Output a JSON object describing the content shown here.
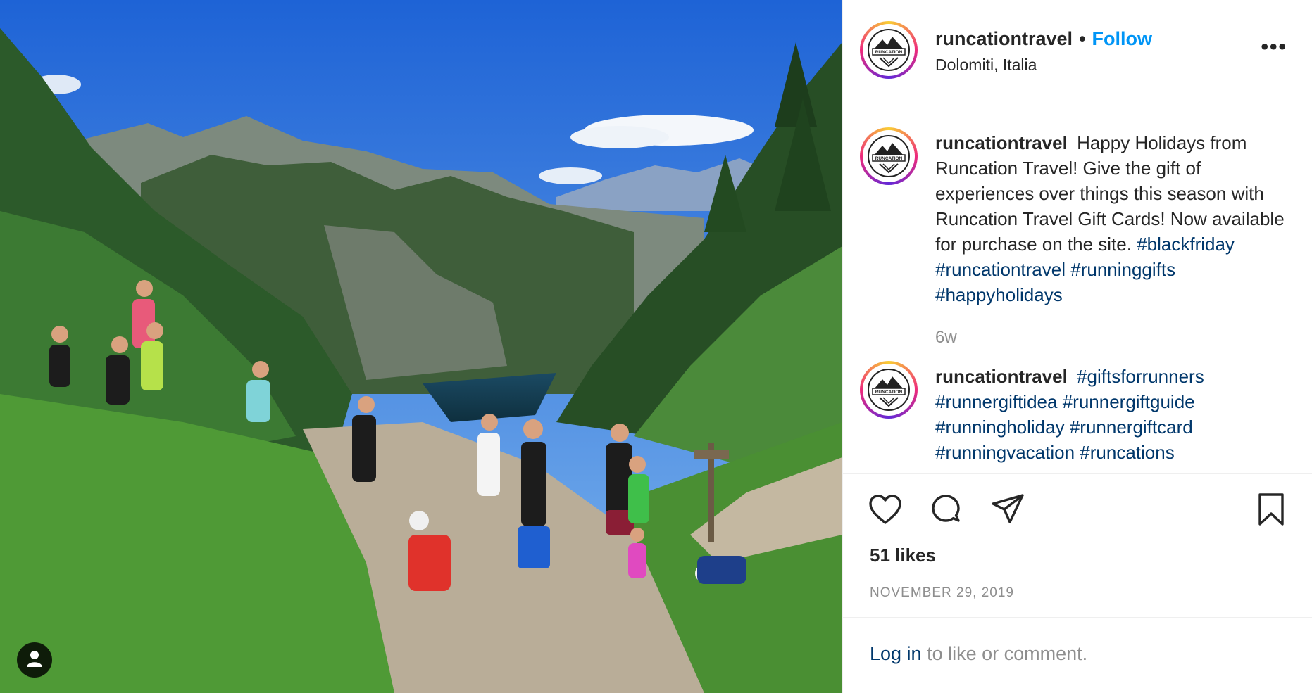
{
  "post": {
    "username": "runcationtravel",
    "follow_label": "Follow",
    "dot": "•",
    "location": "Dolomiti, Italia",
    "more_icon": "more-options-icon",
    "more_glyph": "•••",
    "avatar_logo_text": "RUNCATION"
  },
  "comments": [
    {
      "username": "runcationtravel",
      "text": "Happy Holidays from Runcation Travel! Give the gift of experiences over things this season with Runcation Travel Gift Cards! Now available for purchase on the site.",
      "hashtags": [
        "#blackfriday",
        "#runcationtravel",
        "#runninggifts",
        "#happyholidays"
      ],
      "time": "6w"
    },
    {
      "username": "runcationtravel",
      "text": "",
      "hashtags": [
        "#giftsforrunners",
        "#runnergiftidea",
        "#runnergiftguide",
        "#runningholiday",
        "#runnergiftcard",
        "#runningvacation",
        "#runcations"
      ]
    }
  ],
  "actions": {
    "like_icon": "heart-icon",
    "comment_icon": "comment-icon",
    "share_icon": "share-icon",
    "save_icon": "bookmark-icon"
  },
  "likes": "51 likes",
  "date": "NOVEMBER 29, 2019",
  "footer": {
    "login_link": "Log in",
    "login_rest": " to like or comment."
  },
  "colors": {
    "follow": "#0095f6",
    "hashtag": "#00376b",
    "muted": "#8e8e8e",
    "text": "#262626",
    "border": "#efefef"
  }
}
